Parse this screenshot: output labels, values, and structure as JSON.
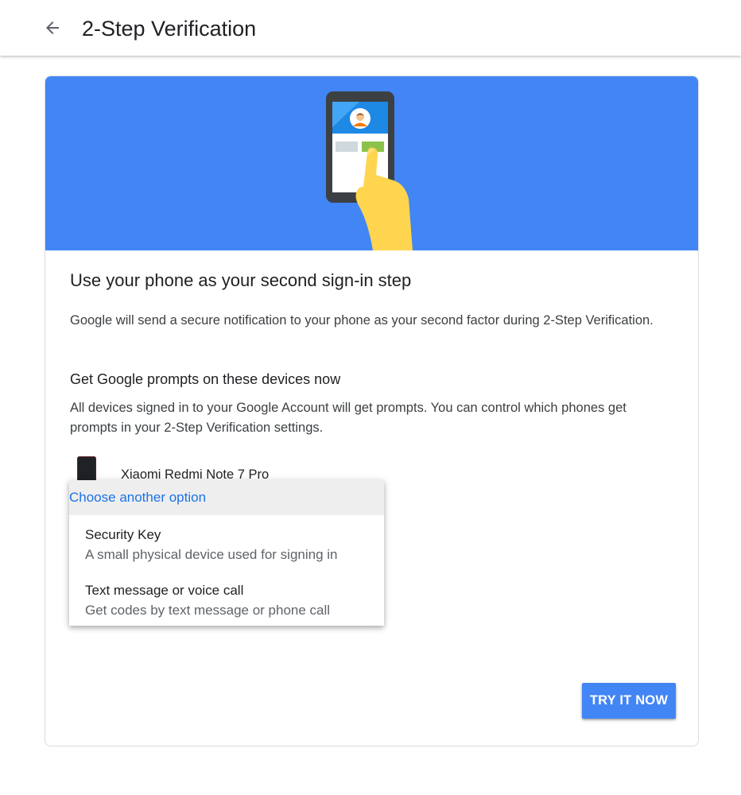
{
  "header": {
    "back_icon": "arrow-back-icon",
    "title": "2-Step Verification"
  },
  "hero": {
    "illustration": "phone-prompt-illustration",
    "background_color": "#4285f4"
  },
  "content": {
    "heading": "Use your phone as your second sign-in step",
    "description": "Google will send a secure notification to your phone as your second factor during 2-Step Verification.",
    "subheading": "Get Google prompts on these devices now",
    "subdescription": "All devices signed in to your Google Account will get prompts. You can control which phones get prompts in your 2-Step Verification settings.",
    "devices": [
      {
        "icon": "smartphone-icon",
        "name": "Xiaomi Redmi Note 7 Pro"
      }
    ]
  },
  "menu": {
    "header": "Choose another option",
    "options": [
      {
        "title": "Security Key",
        "subtitle": "A small physical device used for signing in"
      },
      {
        "title": "Text message or voice call",
        "subtitle": "Get codes by text message or phone call"
      }
    ]
  },
  "actions": {
    "try_label": "TRY IT NOW",
    "accent_color": "#4285f4",
    "link_color": "#1a73e8"
  }
}
